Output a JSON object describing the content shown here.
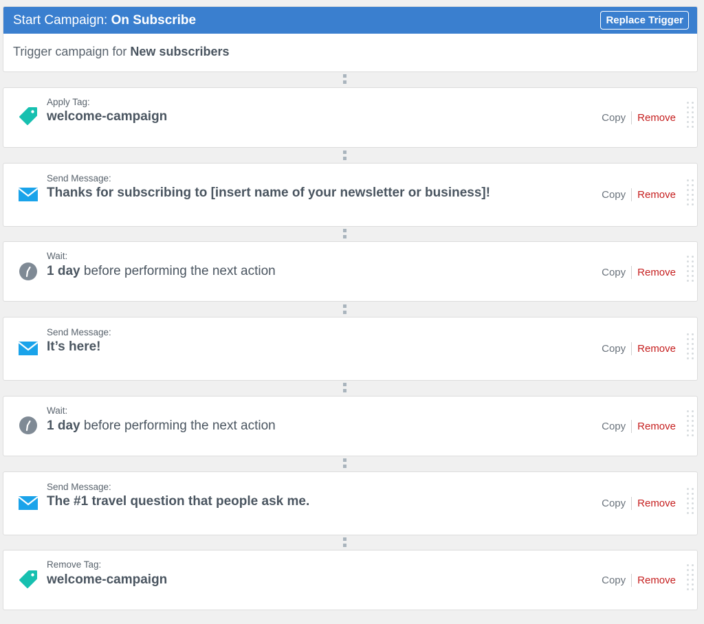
{
  "trigger": {
    "title_prefix": "Start Campaign:",
    "title_event": "On Subscribe",
    "replace_label": "Replace Trigger",
    "body_prefix": "Trigger campaign for",
    "body_target": "New subscribers",
    "header_color": "#3a7fcf"
  },
  "steps": [
    {
      "type": "tag",
      "icon": "tag-icon",
      "label": "Apply Tag:",
      "value": "welcome-campaign",
      "copy": "Copy",
      "remove": "Remove"
    },
    {
      "type": "message",
      "icon": "envelope-icon",
      "label": "Send Message:",
      "value": "Thanks for subscribing to [insert name of your newsletter or business]!",
      "copy": "Copy",
      "remove": "Remove"
    },
    {
      "type": "wait",
      "icon": "clock-icon",
      "label": "Wait:",
      "value_strong": "1 day",
      "value_rest": "before performing the next action",
      "copy": "Copy",
      "remove": "Remove"
    },
    {
      "type": "message",
      "icon": "envelope-icon",
      "label": "Send Message:",
      "value": "It’s here!",
      "copy": "Copy",
      "remove": "Remove"
    },
    {
      "type": "wait",
      "icon": "clock-icon",
      "label": "Wait:",
      "value_strong": "1 day",
      "value_rest": "before performing the next action",
      "copy": "Copy",
      "remove": "Remove"
    },
    {
      "type": "message",
      "icon": "envelope-icon",
      "label": "Send Message:",
      "value": "The #1 travel question that people ask me.",
      "copy": "Copy",
      "remove": "Remove"
    },
    {
      "type": "tag",
      "icon": "tag-icon",
      "label": "Remove Tag:",
      "value": "welcome-campaign",
      "copy": "Copy",
      "remove": "Remove"
    }
  ],
  "colors": {
    "tag": "#17c0b0",
    "message": "#1aa3ea",
    "wait": "#7f8a95",
    "remove": "#c51d1d"
  }
}
